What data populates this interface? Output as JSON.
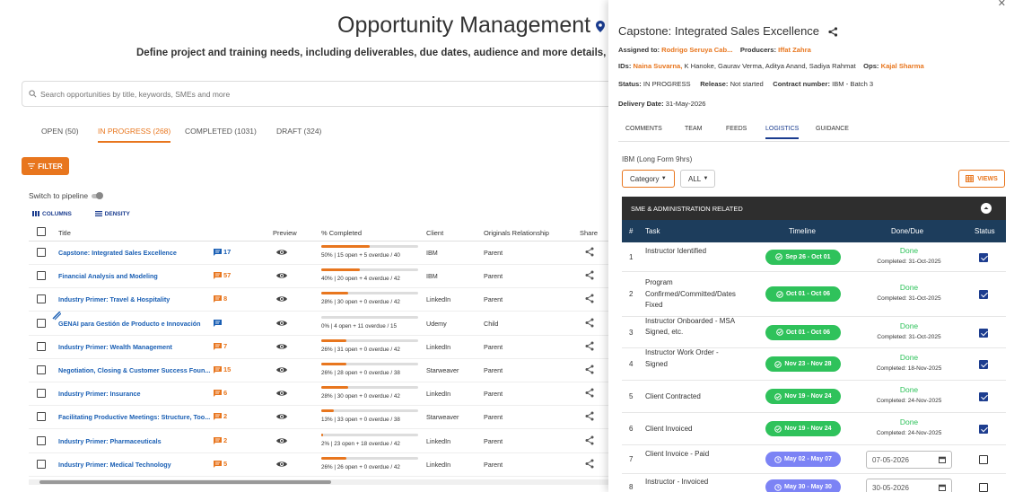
{
  "header": {
    "title": "Opportunity Management",
    "subtitle": "Define project and training needs, including deliverables, due dates, audience and more details, to secure proj"
  },
  "search": {
    "placeholder": "Search opportunities by title, keywords, SMEs and more"
  },
  "tabs": [
    {
      "label": "OPEN (50)"
    },
    {
      "label": "IN PROGRESS (268)"
    },
    {
      "label": "COMPLETED (1031)"
    },
    {
      "label": "DRAFT (324)"
    }
  ],
  "filter_label": "FILTER",
  "switch_label": "Switch to pipeline",
  "grid_tools": {
    "columns": "COLUMNS",
    "density": "DENSITY"
  },
  "columns": [
    "Title",
    "Preview",
    "% Completed",
    "Client",
    "Originals Relationship",
    "Share"
  ],
  "rows": [
    {
      "title": "Capstone: Integrated Sales Excellence",
      "comments": "17",
      "comment_color": "#1a5fb4",
      "progress": 50,
      "progress_text": "50% | 15 open + 5 overdue / 40",
      "client": "IBM",
      "relationship": "Parent"
    },
    {
      "title": "Financial Analysis and Modeling",
      "comments": "57",
      "comment_color": "#e8761e",
      "progress": 40,
      "progress_text": "40% | 20 open + 4 overdue / 42",
      "client": "IBM",
      "relationship": "Parent"
    },
    {
      "title": "Industry Primer: Travel & Hospitality",
      "comments": "8",
      "comment_color": "#e8761e",
      "progress": 28,
      "progress_text": "28% | 30 open + 0 overdue / 42",
      "client": "LinkedIn",
      "relationship": "Parent"
    },
    {
      "title": "GENAI para Gestión de Producto e Innovación",
      "comments": "",
      "comment_color": "#1a5fb4",
      "progress": 0,
      "progress_text": "0% | 4 open + 11 overdue / 15",
      "client": "Udemy",
      "relationship": "Child"
    },
    {
      "title": "Industry Primer: Wealth Management",
      "comments": "7",
      "comment_color": "#e8761e",
      "progress": 26,
      "progress_text": "26% | 31 open + 0 overdue / 42",
      "client": "LinkedIn",
      "relationship": "Parent"
    },
    {
      "title": "Negotiation, Closing & Customer Success Foun...",
      "comments": "15",
      "comment_color": "#e8761e",
      "progress": 26,
      "progress_text": "26% | 28 open + 0 overdue / 38",
      "client": "Starweaver",
      "relationship": "Parent"
    },
    {
      "title": "Industry Primer: Insurance",
      "comments": "6",
      "comment_color": "#e8761e",
      "progress": 28,
      "progress_text": "28% | 30 open + 0 overdue / 42",
      "client": "LinkedIn",
      "relationship": "Parent"
    },
    {
      "title": "Facilitating Productive Meetings: Structure, Too...",
      "comments": "2",
      "comment_color": "#e8761e",
      "progress": 13,
      "progress_text": "13% | 33 open + 0 overdue / 38",
      "client": "Starweaver",
      "relationship": "Parent"
    },
    {
      "title": "Industry Primer: Pharmaceuticals",
      "comments": "2",
      "comment_color": "#e8761e",
      "progress": 2,
      "progress_text": "2% | 23 open + 18 overdue / 42",
      "client": "LinkedIn",
      "relationship": "Parent"
    },
    {
      "title": "Industry Primer: Medical Technology",
      "comments": "5",
      "comment_color": "#e8761e",
      "progress": 26,
      "progress_text": "26% | 26 open + 0 overdue / 42",
      "client": "LinkedIn",
      "relationship": "Parent"
    }
  ],
  "panel": {
    "title": "Capstone: Integrated Sales Excellence",
    "assigned_label": "Assigned to:",
    "assigned_value": "Rodrigo Seruya Cab...",
    "producers_label": "Producers:",
    "producers_value": "Iffat Zahra",
    "ids_label": "IDs:",
    "ids_primary": "Naina Suvarna,",
    "ids_rest": "K Hanoke,   Gaurav Verma,   Aditya Anand,   Sadiya Rahmat",
    "ops_label": "Ops:",
    "ops_value": "Kajal Sharma",
    "status_label": "Status:",
    "status_value": "IN PROGRESS",
    "release_label": "Release:",
    "release_value": "Not started",
    "contract_label": "Contract number:",
    "contract_value": "IBM - Batch 3",
    "delivery_label": "Delivery Date:",
    "delivery_value": "31-May-2026",
    "tabs": [
      "COMMENTS",
      "TEAM",
      "FEEDS",
      "LOGISTICS",
      "GUIDANCE"
    ],
    "program": "IBM (Long Form 9hrs)",
    "category": "Category",
    "all": "ALL",
    "views": "VIEWS",
    "section": "SME & ADMINISTRATION RELATED",
    "table_headers": [
      "#",
      "Task",
      "Timeline",
      "Done/Due",
      "Status"
    ],
    "tasks": [
      {
        "num": "1",
        "task": "Instructor Identified",
        "timeline": "Sep 26  -  Oct 01",
        "tl_color": "g",
        "done": "Done",
        "completed": "Completed: 31-Oct-2025",
        "due": "",
        "checked": true
      },
      {
        "num": "2",
        "task": "Program Confirmed/Committed/Dates Fixed",
        "timeline": "Oct 01  -  Oct 06",
        "tl_color": "g",
        "done": "Done",
        "completed": "Completed: 31-Oct-2025",
        "due": "",
        "checked": true
      },
      {
        "num": "3",
        "task": "Instructor Onboarded - MSA Signed, etc.",
        "timeline": "Oct 01  -  Oct 06",
        "tl_color": "g",
        "done": "Done",
        "completed": "Completed: 31-Oct-2025",
        "due": "",
        "checked": true
      },
      {
        "num": "4",
        "task": "Instructor Work Order - Signed",
        "timeline": "Nov 23  -  Nov 28",
        "tl_color": "g",
        "done": "Done",
        "completed": "Completed: 18-Nov-2025",
        "due": "",
        "checked": true
      },
      {
        "num": "5",
        "task": "Client Contracted",
        "timeline": "Nov 19  -  Nov 24",
        "tl_color": "g",
        "done": "Done",
        "completed": "Completed: 24-Nov-2025",
        "due": "",
        "checked": true
      },
      {
        "num": "6",
        "task": "Client Invoiced",
        "timeline": "Nov 19  -  Nov 24",
        "tl_color": "g",
        "done": "Done",
        "completed": "Completed: 24-Nov-2025",
        "due": "",
        "checked": true
      },
      {
        "num": "7",
        "task": "Client Invoice - Paid",
        "timeline": "May 02  -  May 07",
        "tl_color": "p",
        "done": "",
        "completed": "",
        "due": "07-05-2026",
        "checked": false
      },
      {
        "num": "8",
        "task": "Instructor - Invoiced",
        "timeline": "May 30  -  May 30",
        "tl_color": "p",
        "done": "",
        "completed": "",
        "due": "30-05-2026",
        "checked": false
      }
    ]
  }
}
